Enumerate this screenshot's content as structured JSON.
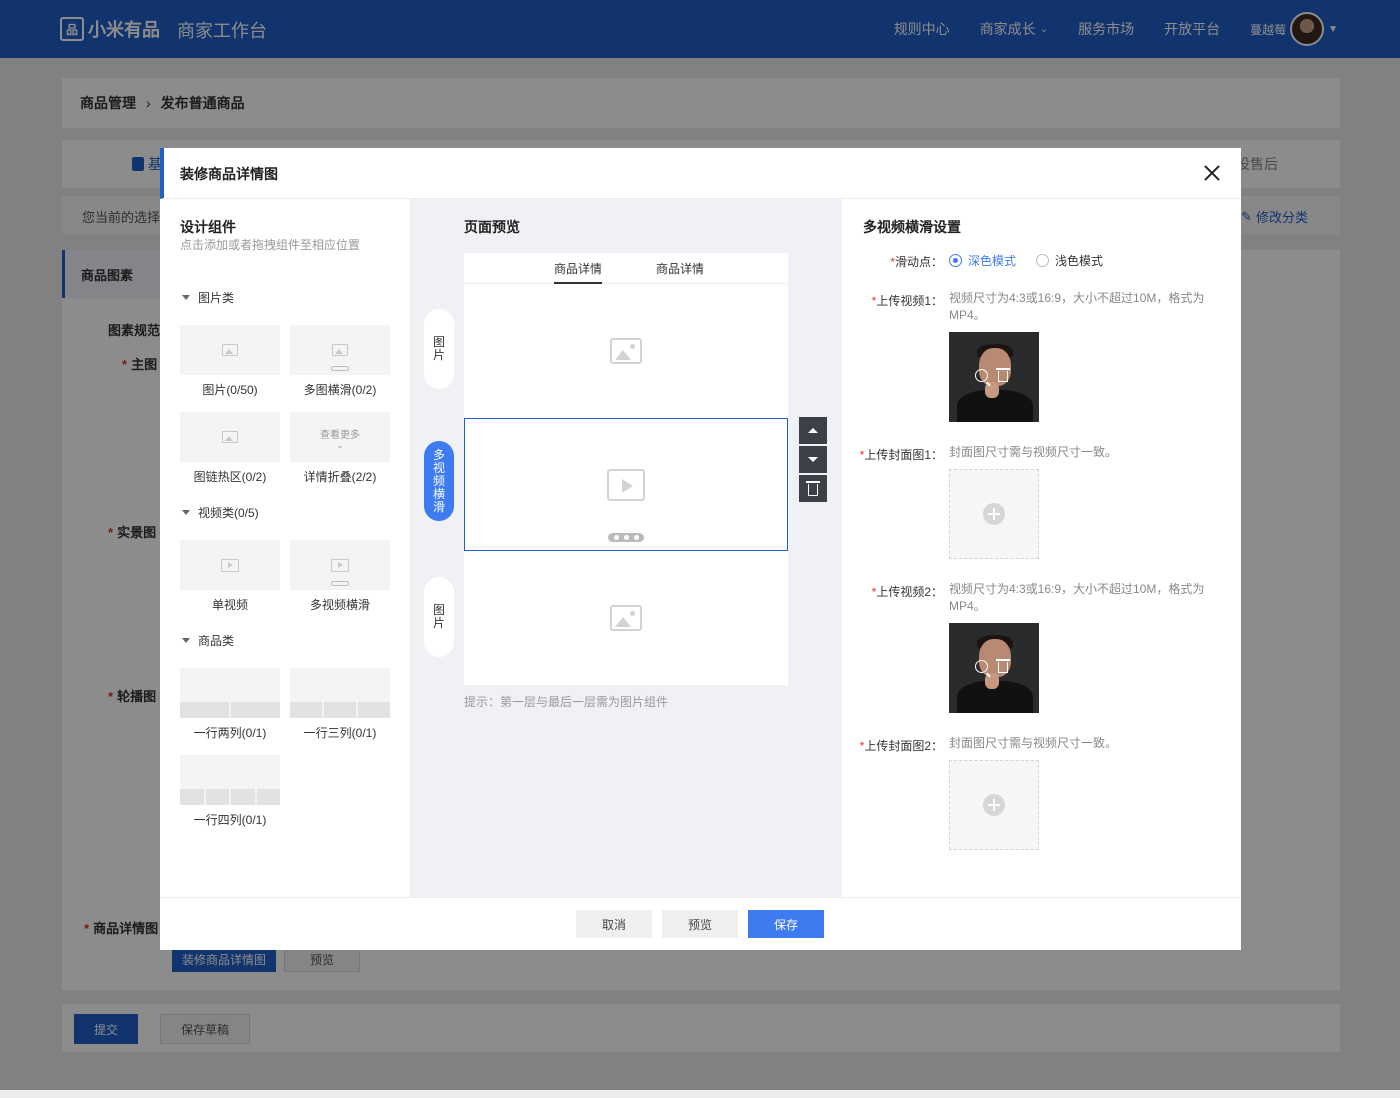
{
  "topbar": {
    "logo_mark": "品",
    "logo_text": "小米有品",
    "workbench": "商家工作台",
    "nav": [
      "规则中心",
      "商家成长",
      "服务市场",
      "开放平台"
    ],
    "user_name": "蔓越莓"
  },
  "page": {
    "breadcrumb": [
      "商品管理",
      "发布普通商品"
    ],
    "tab_basic": "基",
    "tab_after": "设售后",
    "select_prefix": "您当前的选择",
    "modify_category": "修改分类",
    "side_section": "商品图素",
    "label_spec": "图素规范",
    "label_main": "主图",
    "label_real": "实景图",
    "label_carousel": "轮播图",
    "label_detail": "商品详情图",
    "btn_decorate": "装修商品详情图",
    "btn_preview": "预览",
    "btn_submit": "提交",
    "btn_draft": "保存草稿"
  },
  "modal": {
    "title": "装修商品详情图",
    "left": {
      "title": "设计组件",
      "subtitle": "点击添加或者拖拽组件至相应位置",
      "groups": [
        {
          "name": "图片类",
          "items": [
            "图片(0/50)",
            "多图横滑(0/2)",
            "图链热区(0/2)",
            "详情折叠(2/2)"
          ]
        },
        {
          "name": "视频类(0/5)",
          "items": [
            "单视频",
            "多视频横滑"
          ]
        },
        {
          "name": "商品类",
          "items": [
            "一行两列(0/1)",
            "一行三列(0/1)",
            "一行四列(0/1)"
          ]
        }
      ],
      "fold_text": "查看更多"
    },
    "center": {
      "title": "页面预览",
      "tabs": [
        "商品详情",
        "商品详情"
      ],
      "pills": [
        "图片",
        "多视频横滑",
        "图片"
      ],
      "hint": "提示：第一层与最后一层需为图片组件"
    },
    "right": {
      "title": "多视频横滑设置",
      "slider_label": "滑动点：",
      "slider_options": [
        "深色模式",
        "浅色模式"
      ],
      "video1_label": "上传视频1：",
      "video1_desc": "视频尺寸为4:3或16:9，大小不超过10M，格式为MP4。",
      "cover1_label": "上传封面图1：",
      "cover1_desc": "封面图尺寸需与视频尺寸一致。",
      "video2_label": "上传视频2：",
      "video2_desc": "视频尺寸为4:3或16:9，大小不超过10M，格式为MP4。",
      "cover2_label": "上传封面图2：",
      "cover2_desc": "封面图尺寸需与视频尺寸一致。",
      "required_mark": "*"
    },
    "footer": {
      "cancel": "取消",
      "preview": "预览",
      "save": "保存"
    }
  },
  "colors": {
    "brand": "#1f5fc9",
    "accent": "#3e7bf0",
    "required": "#e5322d"
  }
}
